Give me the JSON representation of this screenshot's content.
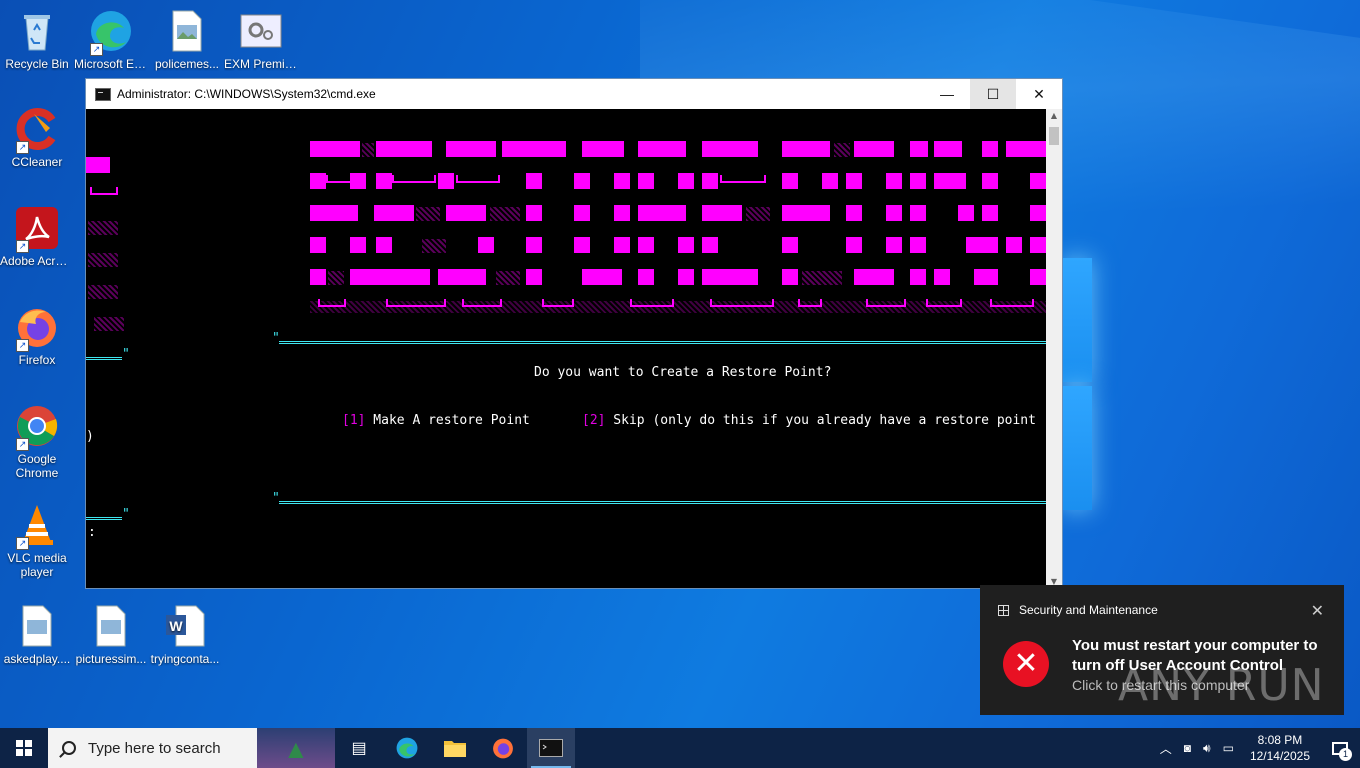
{
  "desktop": {
    "icons": [
      {
        "label": "Recycle Bin"
      },
      {
        "label": "Microsoft Edge"
      },
      {
        "label": "policemes..."
      },
      {
        "label": "EXM Premium..."
      },
      {
        "label": "CCleaner"
      },
      {
        "label": "Adobe Acrobat"
      },
      {
        "label": "Firefox"
      },
      {
        "label": "Google Chrome"
      },
      {
        "label": "VLC media player"
      },
      {
        "label": "askedplay...."
      },
      {
        "label": "picturessim..."
      },
      {
        "label": "tryingconta..."
      }
    ]
  },
  "cmd": {
    "title": "Administrator: C:\\WINDOWS\\System32\\cmd.exe",
    "question": "Do you want to Create a Restore Point?",
    "option1_num": "[1]",
    "option1_text": " Make A restore Point",
    "option2_num": "[2]",
    "option2_text": " Skip (only do this if you already have a restore point",
    "wrap_paren": ")",
    "prompt_colon": ":",
    "quote_mark": "\""
  },
  "toast": {
    "app": "Security and Maintenance",
    "message": "You must restart your computer to turn off User Account Control",
    "sub": "Click to restart this computer"
  },
  "watermark": "ANY RUN",
  "taskbar": {
    "search_placeholder": "Type here to search",
    "time": "8:08 PM",
    "date": "12/14/2025",
    "notification_count": "1"
  }
}
